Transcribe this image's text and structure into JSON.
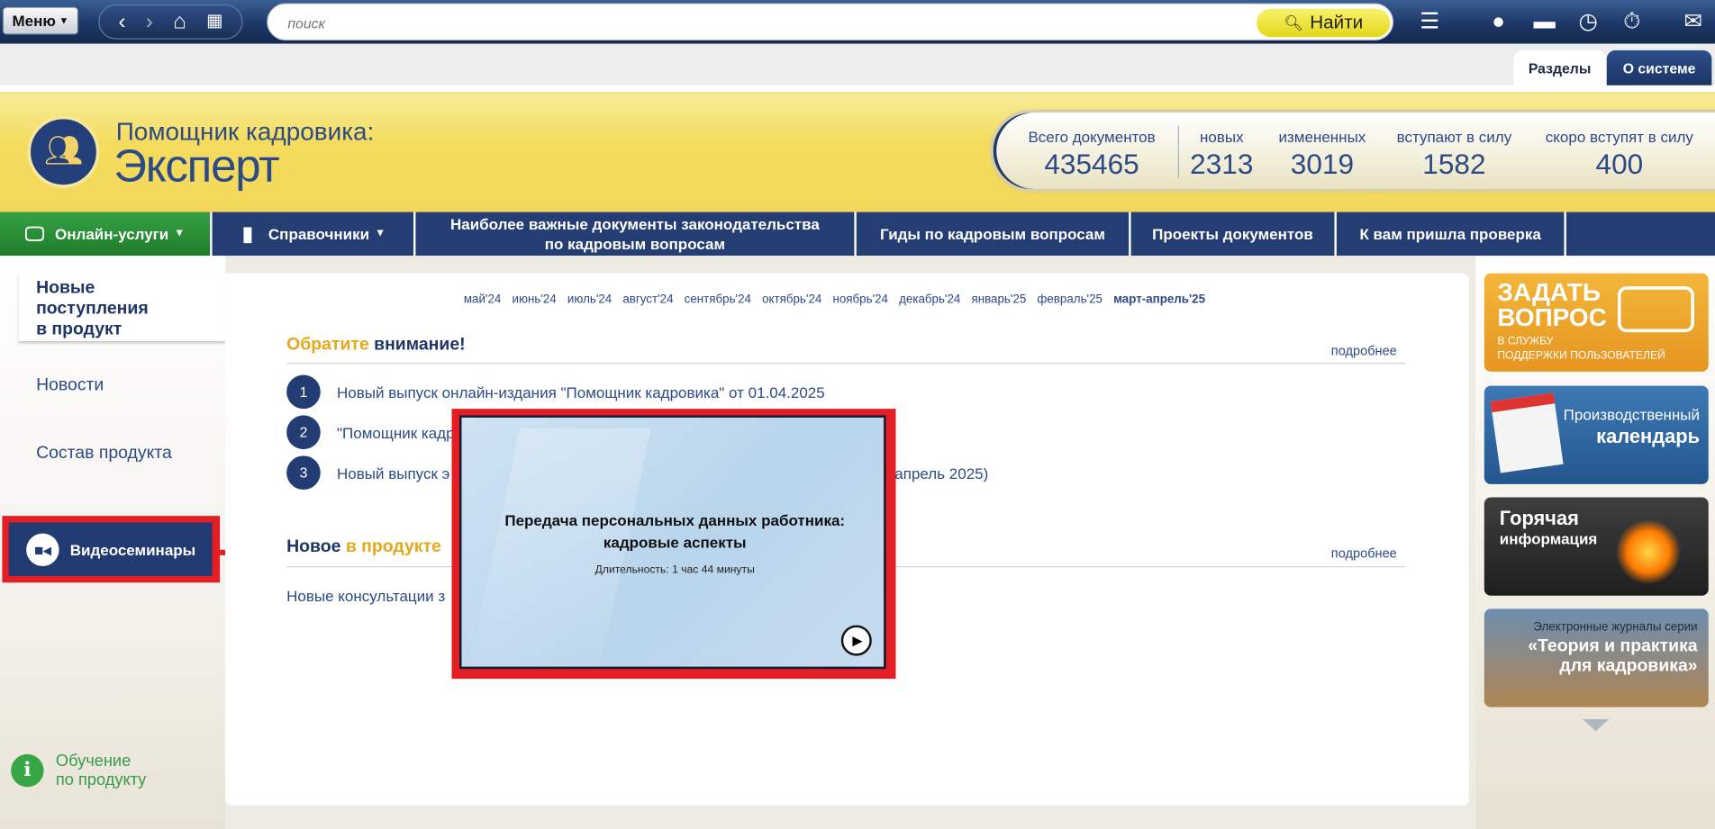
{
  "toolbar": {
    "menu_label": "Меню",
    "search_placeholder": "поиск",
    "find_label": "Найти"
  },
  "tabs": [
    {
      "label": "Разделы"
    },
    {
      "label": "О системе"
    }
  ],
  "brand": {
    "subtitle": "Помощник кадровика:",
    "title": "Эксперт"
  },
  "stats": [
    {
      "label": "Всего документов",
      "value": "435465"
    },
    {
      "label": "новых",
      "value": "2313"
    },
    {
      "label": "измененных",
      "value": "3019"
    },
    {
      "label": "вступают в силу",
      "value": "1582"
    },
    {
      "label": "скоро вступят в силу",
      "value": "400"
    }
  ],
  "nav": {
    "online": "Онлайн-услуги",
    "sprav": "Справочники",
    "important_line1": "Наиболее важные документы законодательства",
    "important_line2": "по кадровым вопросам",
    "guides": "Гиды по кадровым вопросам",
    "projects": "Проекты документов",
    "check": "К вам пришла проверка"
  },
  "sidebar": {
    "new_line1": "Новые",
    "new_line2": "поступления",
    "new_line3": "в продукт",
    "news": "Новости",
    "composition": "Состав продукта",
    "video": "Видеосеминары",
    "training_line1": "Обучение",
    "training_line2": "по продукту"
  },
  "months": [
    "май'24",
    "июнь'24",
    "июль'24",
    "август'24",
    "сентябрь'24",
    "октябрь'24",
    "ноябрь'24",
    "декабрь'24",
    "январь'25",
    "февраль'25",
    "март-апрель'25"
  ],
  "attention": {
    "title_part1": "Обратите",
    "title_part2": "внимание!",
    "more": "подробнее",
    "items": [
      {
        "num": "1",
        "text": "Новый выпуск онлайн-издания \"Помощник кадровика\" от 01.04.2025"
      },
      {
        "num": "2",
        "text": "\"Помощник кадр"
      },
      {
        "num": "3",
        "text": "Новый выпуск э"
      }
    ],
    "item3_tail": "апрель 2025)"
  },
  "new_in_product": {
    "title_part1": "Новое",
    "title_part2": "в продукте",
    "more": "подробнее",
    "line": "Новые консультации з"
  },
  "popup": {
    "title_line1": "Передача персональных данных работника:",
    "title_line2": "кадровые аспекты",
    "duration": "Длительность: 1 час 44 минуты"
  },
  "promos": {
    "ask_title1": "ЗАДАТЬ",
    "ask_title2": "ВОПРОС",
    "ask_sub1": "В СЛУЖБУ",
    "ask_sub2": "ПОДДЕРЖКИ ПОЛЬЗОВАТЕЛЕЙ",
    "cal_line1": "Производственный",
    "cal_line2": "календарь",
    "hot_line1": "Горячая",
    "hot_line2": "информация",
    "mag_line1": "Электронные журналы серии",
    "mag_line2": "«Теория и практика",
    "mag_line3": "для кадровика»"
  },
  "colors": {
    "red_highlight": "#e31e24",
    "navy": "#243d73",
    "green": "#38a547",
    "gold": "#e6a81a"
  }
}
